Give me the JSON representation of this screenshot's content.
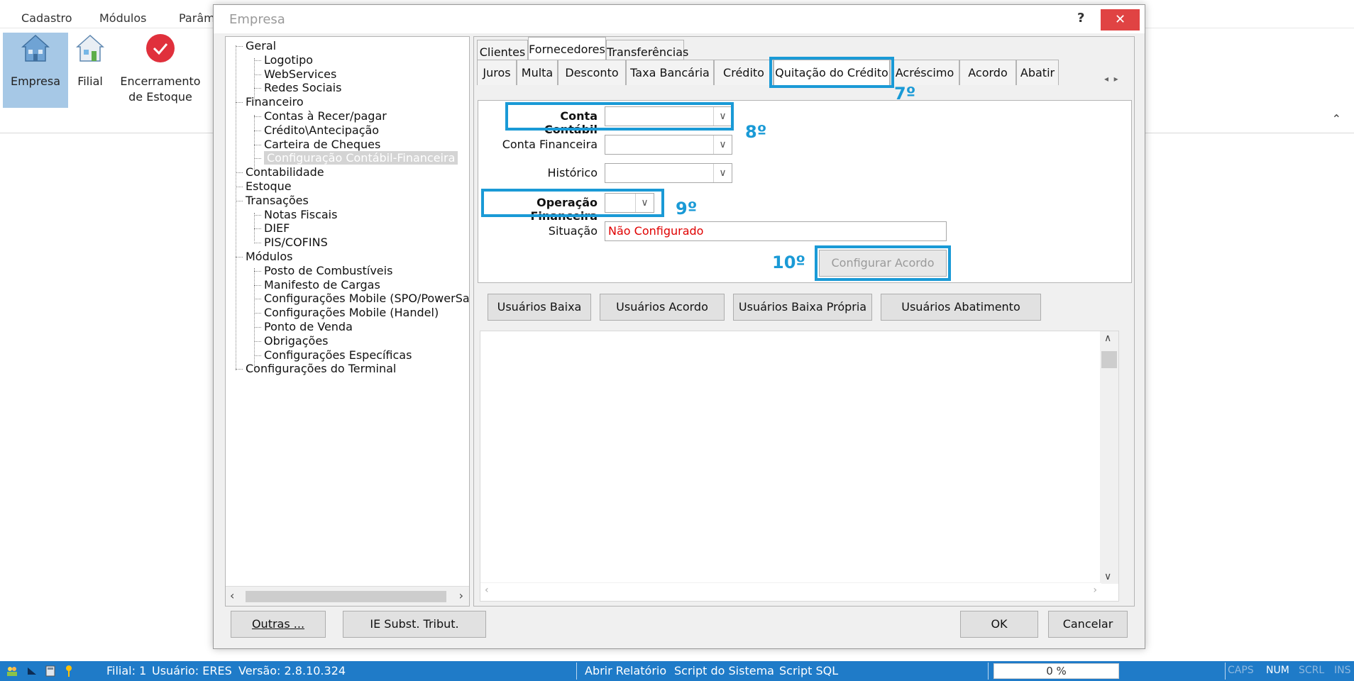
{
  "menubar": {
    "items": [
      "Cadastro",
      "Módulos",
      "Parâm"
    ]
  },
  "ribbon": {
    "buttons": [
      {
        "label": "Empresa",
        "icon": "house-icon"
      },
      {
        "label": "Filial",
        "icon": "house-icon"
      },
      {
        "label": "Encerramento de Estoque",
        "line1": "Encerramento",
        "line2": "de Estoque",
        "icon": "check-circle-icon"
      }
    ],
    "collapse_icon": "chevron-up-icon"
  },
  "dialog": {
    "title": "Empresa",
    "help": "?",
    "close": "✕",
    "tree": {
      "nodes": [
        {
          "label": "Geral",
          "level": 0
        },
        {
          "label": "Logotipo",
          "level": 1
        },
        {
          "label": "WebServices",
          "level": 1
        },
        {
          "label": "Redes Sociais",
          "level": 1
        },
        {
          "label": "Financeiro",
          "level": 0
        },
        {
          "label": "Contas à Recer/pagar",
          "level": 1
        },
        {
          "label": "Crédito\\Antecipação",
          "level": 1
        },
        {
          "label": "Carteira de Cheques",
          "level": 1
        },
        {
          "label": "Configuração Contábil-Financeira",
          "level": 1,
          "selected": true
        },
        {
          "label": "Contabilidade",
          "level": 0
        },
        {
          "label": "Estoque",
          "level": 0
        },
        {
          "label": "Transações",
          "level": 0
        },
        {
          "label": "Notas Fiscais",
          "level": 1
        },
        {
          "label": "DIEF",
          "level": 1
        },
        {
          "label": "PIS/COFINS",
          "level": 1
        },
        {
          "label": "Módulos",
          "level": 0
        },
        {
          "label": "Posto de Combustíveis",
          "level": 1
        },
        {
          "label": "Manifesto de Cargas",
          "level": 1
        },
        {
          "label": "Configurações Mobile (SPO/PowerSa",
          "level": 1
        },
        {
          "label": "Configurações Mobile (Handel)",
          "level": 1
        },
        {
          "label": "Ponto de Venda",
          "level": 1
        },
        {
          "label": "Obrigações",
          "level": 1
        },
        {
          "label": "Configurações Específicas",
          "level": 1
        },
        {
          "label": "Configurações do Terminal",
          "level": 0
        }
      ]
    },
    "tabs": [
      "Clientes",
      "Fornecedores",
      "Transferências"
    ],
    "active_tab": "Fornecedores",
    "subtabs": [
      "Juros",
      "Multa",
      "Desconto",
      "Taxa Bancária",
      "Crédito",
      "Quitação do Crédito",
      "Acréscimo",
      "Acordo",
      "Abatir"
    ],
    "active_subtab": "Quitação do Crédito",
    "form": {
      "conta_contabil_label": "Conta Contábil",
      "conta_financeira_label": "Conta Financeira",
      "historico_label": "Histórico",
      "operacao_financeira_label": "Operação Financeira",
      "situacao_label": "Situação",
      "situacao_value": "Não Configurado",
      "configurar_acordo": "Configurar Acordo"
    },
    "annotations": {
      "step7": "7º",
      "step8": "8º",
      "step9": "9º",
      "step10": "10º",
      "highlight_color": "#1a9ad6"
    },
    "user_buttons": [
      "Usuários Baixa",
      "Usuários Acordo",
      "Usuários Baixa Própria",
      "Usuários Abatimento"
    ],
    "footer": {
      "outras": "Outras ...",
      "ie_subst": "IE Subst. Tribut.",
      "ok": "OK",
      "cancelar": "Cancelar"
    }
  },
  "statusbar": {
    "filial": "Filial: 1",
    "usuario": "Usuário: ERES",
    "versao": "Versão: 2.8.10.324",
    "abrir_relatorio": "Abrir Relatório",
    "script_sistema": "Script do Sistema",
    "script_sql": "Script SQL",
    "progress": "0 %",
    "caps": "CAPS",
    "num": "NUM",
    "scrl": "SCRL",
    "ins": "INS",
    "background": "#1f7bc8"
  }
}
